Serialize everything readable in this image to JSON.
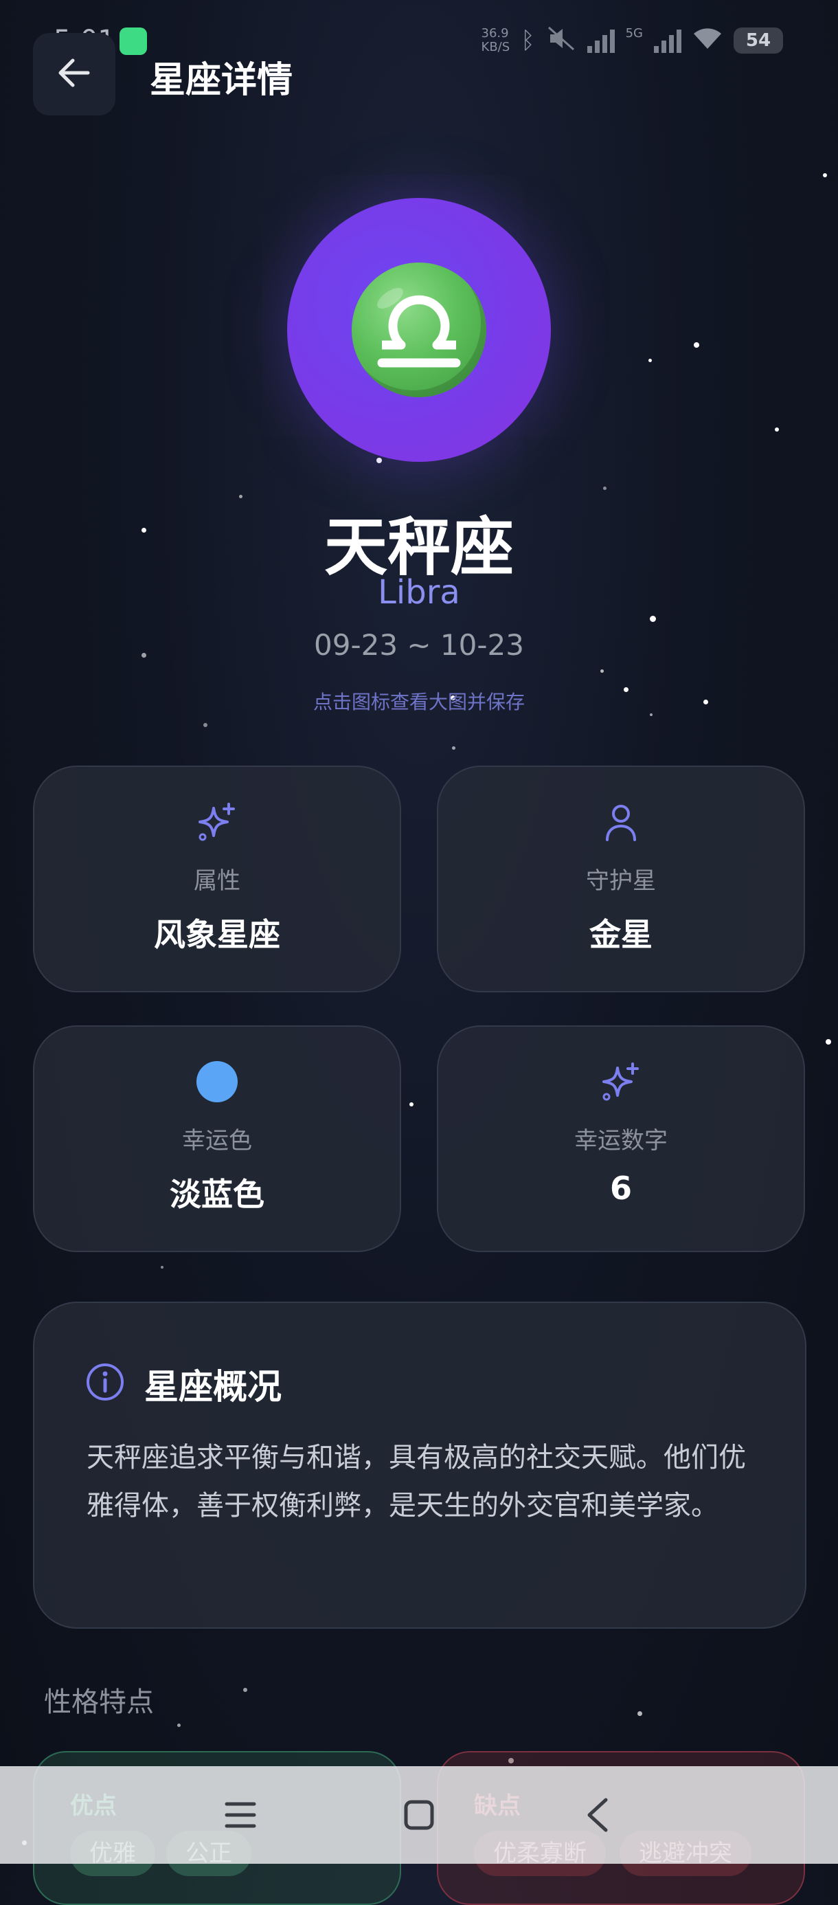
{
  "status_bar": {
    "time": "5:01",
    "net_speed_value": "36.9",
    "net_speed_unit": "KB/S",
    "network_label": "5G",
    "battery": "54"
  },
  "header": {
    "title": "星座详情"
  },
  "hero": {
    "name": "天秤座",
    "english_name": "Libra",
    "date_range": "09-23 ~ 10-23",
    "hint": "点击图标查看大图并保存"
  },
  "cards": [
    {
      "label": "属性",
      "value": "风象星座",
      "icon": "sparkles-icon"
    },
    {
      "label": "守护星",
      "value": "金星",
      "icon": "person-icon"
    },
    {
      "label": "幸运色",
      "value": "淡蓝色",
      "icon": "color-swatch-icon",
      "swatch_color": "#5aa5f5"
    },
    {
      "label": "幸运数字",
      "value": "6",
      "icon": "sparkles-icon"
    }
  ],
  "overview": {
    "title": "星座概况",
    "text": "天秤座追求平衡与和谐，具有极高的社交天赋。他们优雅得体，善于权衡利弊，是天生的外交官和美学家。"
  },
  "traits": {
    "title": "性格特点",
    "pros_label": "优点",
    "pros": [
      "优雅",
      "公正"
    ],
    "cons_label": "缺点",
    "cons": [
      "优柔寡断",
      "逃避冲突"
    ]
  },
  "colors": {
    "accent": "#7b7ff0",
    "hero_circle": "#7a3ae8",
    "background": "#111624"
  }
}
